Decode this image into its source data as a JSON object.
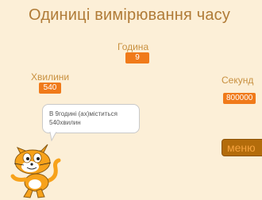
{
  "stage": {
    "title": "Одиниці вимірювання часу",
    "hours": {
      "label": "Година",
      "value": "9"
    },
    "minutes": {
      "label": "Хвилини",
      "value": "540"
    },
    "seconds": {
      "label": "Секунд",
      "value": "800000"
    },
    "speech": {
      "line1": "В 9годині (ах)міститься",
      "line2": "540хвилин"
    },
    "menu_button": {
      "label": "меню"
    }
  },
  "colors": {
    "background": "#fcefd7",
    "monitor": "#f07a1a",
    "title": "#b07b37",
    "button": "#b36c0b"
  },
  "icons": {
    "sprite": "scratch-cat-icon"
  }
}
